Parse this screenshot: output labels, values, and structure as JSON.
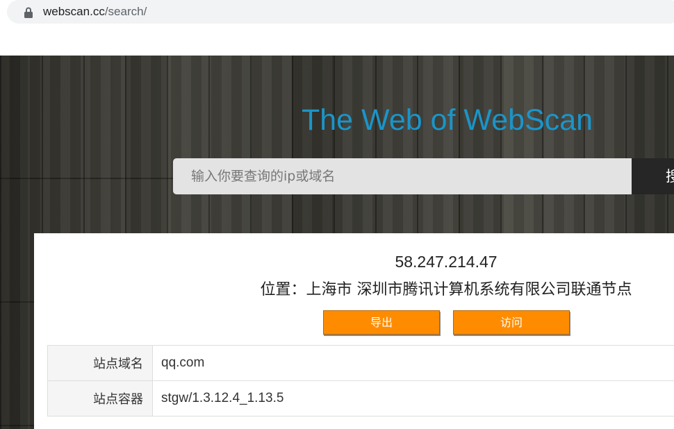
{
  "browser": {
    "url_host": "webscan.cc",
    "url_path": "/search/",
    "lock_icon": "lock-icon"
  },
  "hero": {
    "title": "The Web of WebScan",
    "title_color": "#1a95c9"
  },
  "search": {
    "placeholder": "输入你要查询的ip或域名",
    "button_label": "搜"
  },
  "result": {
    "ip": "58.247.214.47",
    "location": "位置：上海市 深圳市腾讯计算机系统有限公司联通节点",
    "export_label": "导出",
    "visit_label": "访问",
    "button_color": "#ff8c00"
  },
  "table": {
    "rows": [
      {
        "label": "站点域名",
        "value": "qq.com"
      },
      {
        "label": "站点容器",
        "value": "stgw/1.3.12.4_1.13.5"
      }
    ]
  }
}
